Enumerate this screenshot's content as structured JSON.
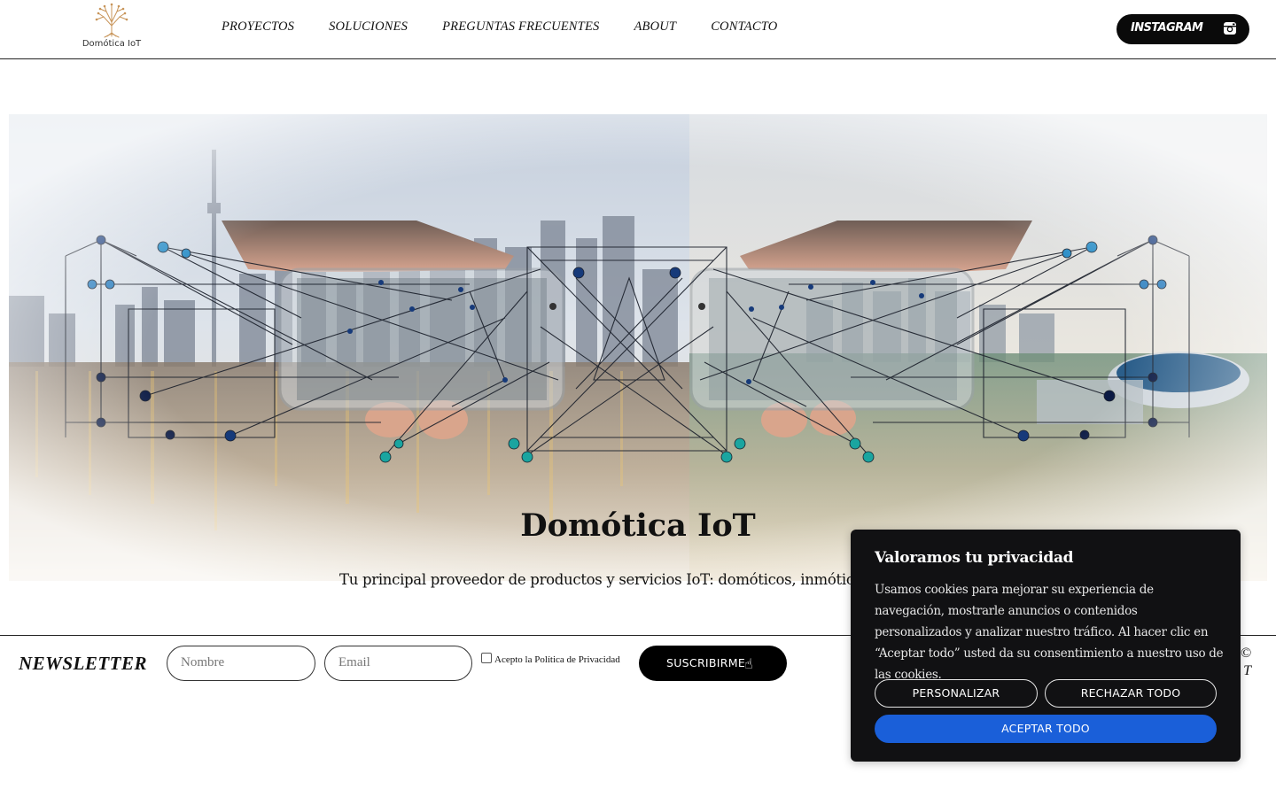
{
  "header": {
    "logo_text": "Domótica IoT",
    "nav": [
      "PROYECTOS",
      "SOLUCIONES",
      "PREGUNTAS FRECUENTES",
      "ABOUT",
      "CONTACTO"
    ],
    "instagram_label": "INSTAGRAM",
    "instagram_icon": "instagram-icon"
  },
  "hero": {
    "title": "Domótica IoT",
    "subtitle": "Tu principal proveedor de productos y servicios IoT: domóticos, inmóticos y d"
  },
  "newsletter": {
    "title": "NEWSLETTER",
    "name_placeholder": "Nombre",
    "email_placeholder": "Email",
    "consent_label": "Acepto la Política de Privacidad",
    "consent_checked": false,
    "submit_label": "SUSCRIBIRME",
    "submit_icon": "pointer-hand-icon"
  },
  "footer": {
    "copyright_fragment": "©",
    "copyright_tail": "T"
  },
  "cookie": {
    "title": "Valoramos tu privacidad",
    "text": "Usamos cookies para mejorar su experiencia de navegación, mostrarle anuncios o contenidos personalizados y analizar nuestro tráfico. Al hacer clic en “Aceptar todo” usted da su consentimiento a nuestro uso de las cookies.",
    "customize_label": "PERSONALIZAR",
    "reject_label": "RECHAZAR TODO",
    "accept_label": "ACEPTAR TODO",
    "accent_color": "#1a5fd9"
  }
}
